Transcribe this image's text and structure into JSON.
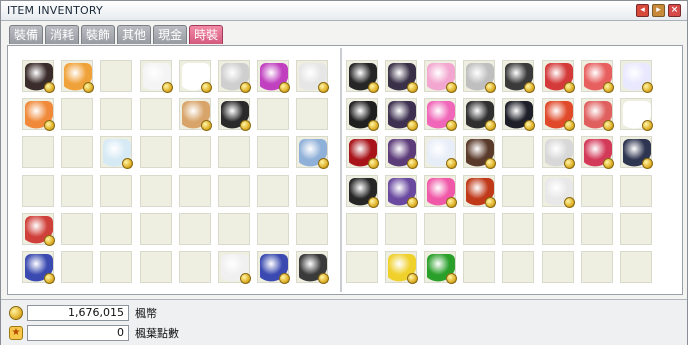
{
  "window": {
    "title": "ITEM INVENTORY"
  },
  "tabs": [
    {
      "label": "裝備",
      "active": false
    },
    {
      "label": "消耗",
      "active": false
    },
    {
      "label": "裝飾",
      "active": false
    },
    {
      "label": "其他",
      "active": false
    },
    {
      "label": "現金",
      "active": false
    },
    {
      "label": "時裝",
      "active": true
    }
  ],
  "footer": {
    "mesos": {
      "value": "1,676,015",
      "label": "楓幣"
    },
    "maple_points": {
      "value": "0",
      "label": "楓葉點數"
    }
  },
  "grid": {
    "columns": 16,
    "rows": 6,
    "slots": [
      [
        "gun",
        "wand",
        "",
        "duck-hat",
        "fur-mask",
        "pouch-pack",
        "yoyo",
        "white-shirt",
        "black-coat",
        "black-ribbon",
        "bow-headband",
        "silver-hair",
        "headphones",
        "red-cap",
        "red-white-hat",
        "wing-cap"
      ],
      [
        "staff",
        "",
        "",
        "",
        "palette",
        "black-cat-hat",
        "",
        "",
        "black-coat-long",
        "shadow-robe",
        "heart-balloon",
        "dark-hair",
        "dark-jacket",
        "red-snail",
        "mushroom-hat",
        "white-cape"
      ],
      [
        "",
        "",
        "blue-shirt",
        "",
        "",
        "",
        "",
        "jeans",
        "red-cape",
        "purple-boots",
        "sailor-top",
        "brown-outfit",
        "",
        "striped-top",
        "red-dress",
        "navy-cape"
      ],
      [
        "",
        "",
        "",
        "",
        "",
        "",
        "",
        "",
        "black-boots",
        "purple-pants",
        "pink-skirt",
        "fire-boots",
        "",
        "white-sneakers",
        "",
        ""
      ],
      [
        "crab-cat",
        "",
        "",
        "",
        "",
        "",
        "",
        "",
        "",
        "",
        "",
        "",
        "",
        "",
        "",
        ""
      ],
      [
        "crown-cushion",
        "",
        "",
        "",
        "",
        "boots",
        "crown-cushion",
        "ninja-helmet",
        "",
        "yellow-blob",
        "green-snake",
        "",
        "",
        "",
        "",
        ""
      ]
    ]
  },
  "icon_colors": {
    "gun": "#3a2c2a",
    "wand": "#f0a23a",
    "duck-hat": "#f4f4f4",
    "fur-mask": "#ffffff",
    "pouch-pack": "#cfcfcf",
    "yoyo": "#c040c0",
    "white-shirt": "#e6e6e6",
    "black-coat": "#262626",
    "black-ribbon": "#3a3148",
    "bow-headband": "#f3a7d0",
    "silver-hair": "#bfbfbf",
    "headphones": "#3a3a3a",
    "red-cap": "#d43a3a",
    "red-white-hat": "#e85f5f",
    "wing-cap": "#e8e8ff",
    "staff": "#f08a3a",
    "palette": "#d8a46a",
    "black-cat-hat": "#2a2a2a",
    "black-coat-long": "#202020",
    "shadow-robe": "#3d3050",
    "heart-balloon": "#f066b8",
    "dark-hair": "#303030",
    "dark-jacket": "#1f1f2a",
    "red-snail": "#e04a2a",
    "mushroom-hat": "#e06060",
    "white-cape": "#ffffff",
    "blue-shirt": "#d6eaf5",
    "jeans": "#8fb0d8",
    "red-cape": "#a8141a",
    "purple-boots": "#5d3c7a",
    "sailor-top": "#e8eef8",
    "brown-outfit": "#5a3a2a",
    "striped-top": "#d8d8d8",
    "red-dress": "#d33a5a",
    "navy-cape": "#2e3550",
    "black-boots": "#262626",
    "purple-pants": "#6a4aa0",
    "pink-skirt": "#f058a8",
    "fire-boots": "#c03a1a",
    "white-sneakers": "#e8e8e8",
    "crab-cat": "#d0403a",
    "crown-cushion": "#3a4ab0",
    "boots": "#f0f0f0",
    "ninja-helmet": "#3a3a3a",
    "yellow-blob": "#f0d02a",
    "green-snake": "#2aa02a"
  }
}
